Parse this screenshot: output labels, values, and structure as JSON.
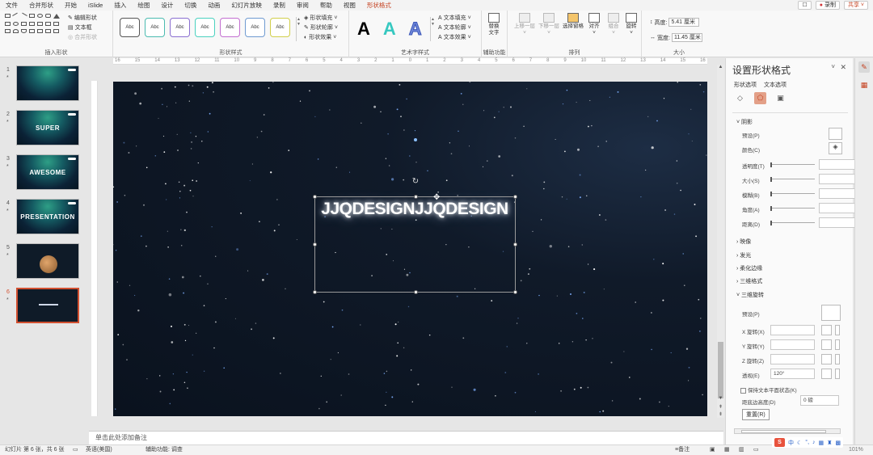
{
  "tabs": [
    "文件",
    "合并形状",
    "开始",
    "iSlide",
    "插入",
    "绘图",
    "设计",
    "切换",
    "动画",
    "幻灯片放映",
    "录制",
    "审阅",
    "帮助",
    "视图",
    "形状格式"
  ],
  "active_tab": "形状格式",
  "tabs_right": {
    "comments_icon": "comment-icon",
    "record_label": "录制",
    "share_label": "共享"
  },
  "ribbon": {
    "insert_shapes": {
      "label": "插入形状",
      "edit_shape": "编辑形状",
      "text_box": "文本框",
      "merge_shapes": "合并形状"
    },
    "shape_styles": {
      "label": "形状样式",
      "samples": [
        "Abc",
        "Abc",
        "Abc",
        "Abc",
        "Abc",
        "Abc",
        "Abc"
      ],
      "sample_colors": [
        "#555555",
        "#4bbbb0",
        "#8a6fd1",
        "#4bd1c0",
        "#c36fd1",
        "#6f9bd1",
        "#d1cf4b"
      ],
      "fill": "形状填充",
      "outline": "形状轮廓",
      "effects": "形状效果"
    },
    "wordart": {
      "label": "艺术字样式",
      "samples": [
        "A",
        "A",
        "A"
      ],
      "text_fill": "文本填充",
      "text_outline": "文本轮廓",
      "text_effects": "文本效果"
    },
    "accessibility": {
      "label": "辅助功能",
      "alt_text": "替换文字"
    },
    "arrange": {
      "label": "排列",
      "bring_forward": "上移一层",
      "send_backward": "下移一层",
      "selection_pane": "选择窗格",
      "align": "对齐",
      "group": "组合",
      "rotate": "旋转"
    },
    "size": {
      "label": "大小",
      "height_label": "高度:",
      "height": "5.41 厘米",
      "width_label": "宽度:",
      "width": "11.45 厘米"
    }
  },
  "thumbnails": [
    {
      "num": "1",
      "text": "",
      "star": "*"
    },
    {
      "num": "2",
      "text": "SUPER",
      "star": "*"
    },
    {
      "num": "3",
      "text": "AWESOME",
      "star": "*"
    },
    {
      "num": "4",
      "text": "PRESENTATION",
      "star": "*"
    },
    {
      "num": "5",
      "text": "",
      "star": "*"
    },
    {
      "num": "6",
      "text": "",
      "star": "*"
    }
  ],
  "ruler_ticks": [
    "16",
    "15",
    "14",
    "13",
    "12",
    "11",
    "10",
    "9",
    "8",
    "7",
    "6",
    "5",
    "4",
    "3",
    "2",
    "1",
    "0",
    "1",
    "2",
    "3",
    "4",
    "5",
    "6",
    "7",
    "8",
    "9",
    "10",
    "11",
    "12",
    "13",
    "14",
    "15",
    "16"
  ],
  "slide": {
    "text": "JJQDESIGNJJQDESIGN"
  },
  "notes_placeholder": "单击此处添加备注",
  "panel": {
    "title": "设置形状格式",
    "tabs": [
      "形状选项",
      "文本选项"
    ],
    "shadow": {
      "header": "阴影",
      "preset": "预设(P)",
      "color": "颜色(C)",
      "transparency": "透明度(T)",
      "size": "大小(S)",
      "blur": "模糊(B)",
      "angle": "角度(A)",
      "distance": "距离(D)"
    },
    "collapsed": [
      "映像",
      "发光",
      "柔化边缘",
      "三维格式"
    ],
    "rotation3d": {
      "header": "三维旋转",
      "preset": "预设(P)",
      "x": "X 旋转(X)",
      "y": "Y 旋转(Y)",
      "z": "Z 旋转(Z)",
      "perspective": "透视(E)",
      "perspective_value": "120°",
      "keep_flat": "保持文本平面状态(K)",
      "distance": "距底边高度(D)",
      "distance_value": "0 磅",
      "reset": "重置(R)"
    }
  },
  "status": {
    "slide_info": "幻灯片 第 6 张，共 6 张",
    "language": "英语(美国)",
    "accessibility": "辅助功能: 调查",
    "notes": "备注",
    "zoom": "101%"
  },
  "ime": {
    "logo": "S",
    "lang": "中"
  }
}
